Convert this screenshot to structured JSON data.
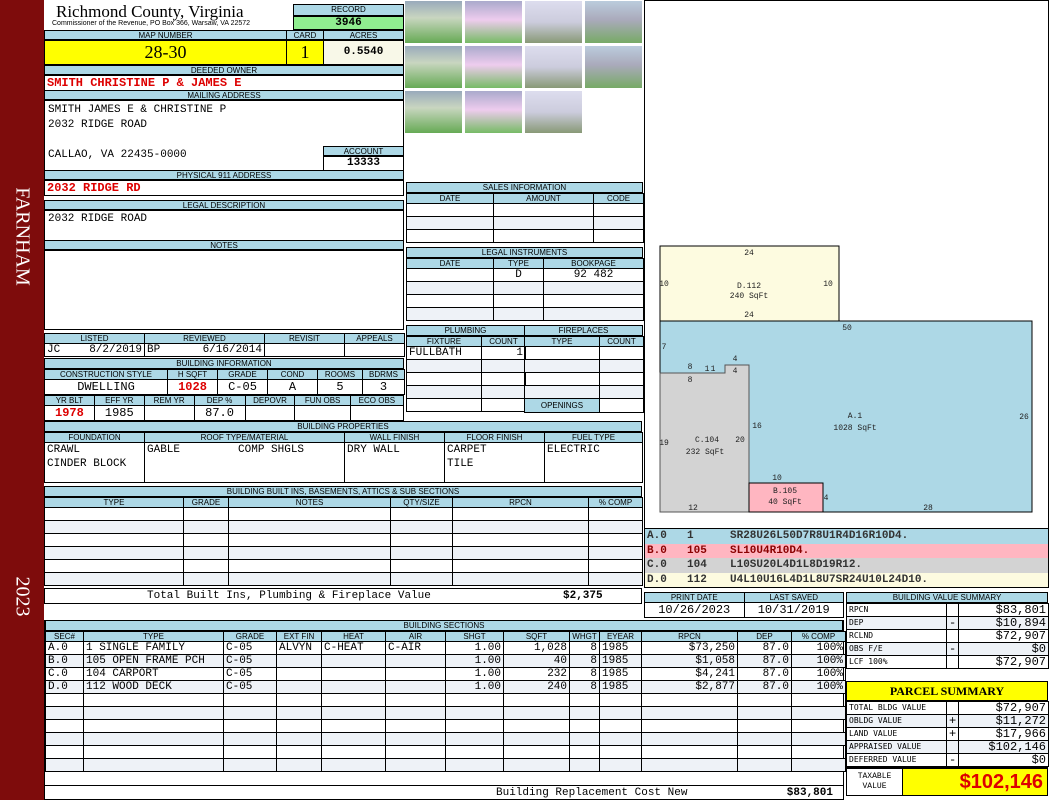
{
  "sidebar": {
    "district": "FARNHAM",
    "year": "2023"
  },
  "header": {
    "title": "Richmond County, Virginia",
    "subtitle": "Commissioner of the Revenue, PO Box 366, Warsaw, VA 22572",
    "record_label": "RECORD",
    "record": "3946"
  },
  "parcel": {
    "map_label": "MAP NUMBER",
    "map": "28-30",
    "card_label": "CARD",
    "card": "1",
    "acres_label": "ACRES",
    "acres": "0.5540"
  },
  "owner": {
    "label": "DEEDED OWNER",
    "value": "SMITH CHRISTINE P & JAMES E"
  },
  "mailing": {
    "label": "MAILING ADDRESS",
    "line1": "SMITH JAMES E & CHRISTINE P",
    "line2": "2032 RIDGE ROAD",
    "line3": "CALLAO, VA 22435-0000",
    "account_label": "ACCOUNT",
    "account": "13333"
  },
  "physical": {
    "label": "PHYSICAL 911 ADDRESS",
    "value": "2032 RIDGE RD"
  },
  "legal": {
    "label": "LEGAL DESCRIPTION",
    "value": "2032 RIDGE ROAD"
  },
  "notes": {
    "label": "NOTES"
  },
  "review": {
    "headers": [
      "LISTED",
      "REVIEWED",
      "REVISIT",
      "APPEALS"
    ],
    "listed_by": "JC",
    "listed": "8/2/2019",
    "reviewed_by": "BP",
    "reviewed": "6/16/2014"
  },
  "building_info": {
    "label": "BUILDING INFORMATION",
    "h1": [
      "CONSTRUCTION STYLE",
      "H SQFT",
      "GRADE",
      "COND",
      "ROOMS",
      "BDRMS"
    ],
    "v1": [
      "DWELLING",
      "1028",
      "C-05",
      "A",
      "5",
      "3"
    ],
    "h2": [
      "YR BLT",
      "EFF YR",
      "REM YR",
      "DEP %",
      "DEPOVR",
      "FUN OBS",
      "ECO OBS"
    ],
    "v2": [
      "1978",
      "1985",
      "",
      "87.0",
      "",
      "",
      ""
    ]
  },
  "properties": {
    "label": "BUILDING PROPERTIES",
    "headers": [
      "FOUNDATION",
      "ROOF TYPE/MATERIAL",
      "WALL FINISH",
      "FLOOR FINISH",
      "FUEL TYPE"
    ],
    "foundation": [
      "CRAWL",
      "CINDER BLOCK"
    ],
    "roof_type": "GABLE",
    "roof_material": "COMP SHGLS",
    "wall": "DRY WALL",
    "floor": [
      "CARPET",
      "TILE"
    ],
    "fuel": "ELECTRIC"
  },
  "builtins": {
    "label": "BUILDING BUILT INS, BASEMENTS, ATTICS & SUB SECTIONS",
    "headers": [
      "TYPE",
      "GRADE",
      "NOTES",
      "QTY/SIZE",
      "RPCN",
      "% COMP"
    ],
    "total_label": "Total Built Ins, Plumbing & Fireplace Value",
    "total": "$2,375"
  },
  "sales": {
    "label": "SALES INFORMATION",
    "headers": [
      "DATE",
      "AMOUNT",
      "CODE"
    ]
  },
  "instruments": {
    "label": "LEGAL INSTRUMENTS",
    "headers": [
      "DATE",
      "TYPE",
      "BOOKPAGE"
    ],
    "rows": [
      [
        "",
        "D",
        "92 482"
      ]
    ]
  },
  "plumbing": {
    "label": "PLUMBING",
    "headers": [
      "FIXTURE",
      "COUNT"
    ],
    "rows": [
      [
        "FULLBATH",
        "1"
      ]
    ]
  },
  "fireplaces": {
    "label": "FIREPLACES",
    "headers": [
      "TYPE",
      "COUNT"
    ],
    "openings_label": "OPENINGS"
  },
  "sketch": {
    "areas": [
      {
        "id": "D.112",
        "sqft": "240 SqFt",
        "color": "#fdfbe0"
      },
      {
        "id": "A.1",
        "sqft": "1028 SqFt",
        "color": "#add8e6"
      },
      {
        "id": "C.104",
        "sqft": "232 SqFt",
        "color": "#d3d3d3"
      },
      {
        "id": "B.105",
        "sqft": "40 SqFt",
        "color": "#ffb6c1"
      }
    ],
    "dims": [
      "24",
      "10",
      "10",
      "24",
      "50",
      "7",
      "8",
      "1",
      "1",
      "4",
      "4",
      "8",
      "16",
      "20",
      "19",
      "26",
      "10",
      "4",
      "12",
      "28"
    ]
  },
  "sketch_legend": [
    {
      "sec": "A.0",
      "code": "1",
      "path": "SR28U26L50D7R8U1R4D16R10D4.",
      "color": "#add8e6"
    },
    {
      "sec": "B.0",
      "code": "105",
      "path": "SL10U4R10D4.",
      "color": "#ffb6c1"
    },
    {
      "sec": "C.0",
      "code": "104",
      "path": "L10SU20L4D1L8D19R12.",
      "color": "#d3d3d3"
    },
    {
      "sec": "D.0",
      "code": "112",
      "path": "U4L10U16L4D1L8U7SR24U10L24D10.",
      "color": "#fdfbe0"
    }
  ],
  "dates": {
    "print_label": "PRINT DATE",
    "print": "10/26/2023",
    "saved_label": "LAST SAVED",
    "saved": "10/31/2019"
  },
  "sections": {
    "label": "BUILDING SECTIONS",
    "headers": [
      "SEC#",
      "TYPE",
      "GRADE",
      "EXT FIN",
      "HEAT",
      "AIR",
      "SHGT",
      "SQFT",
      "WHGT",
      "EYEAR",
      "RPCN",
      "DEP",
      "% COMP"
    ],
    "rows": [
      [
        "A.0",
        "1 SINGLE FAMILY",
        "C-05",
        "ALVYN",
        "C-HEAT",
        "C-AIR",
        "1.00",
        "1,028",
        "8",
        "1985",
        "$73,250",
        "87.0",
        "100%"
      ],
      [
        "B.0",
        "105 OPEN FRAME PCH",
        "C-05",
        "",
        "",
        "",
        "1.00",
        "40",
        "8",
        "1985",
        "$1,058",
        "87.0",
        "100%"
      ],
      [
        "C.0",
        "104 CARPORT",
        "C-05",
        "",
        "",
        "",
        "1.00",
        "232",
        "8",
        "1985",
        "$4,241",
        "87.0",
        "100%"
      ],
      [
        "D.0",
        "112 WOOD DECK",
        "C-05",
        "",
        "",
        "",
        "1.00",
        "240",
        "8",
        "1985",
        "$2,877",
        "87.0",
        "100%"
      ]
    ],
    "footer_label": "Building Replacement Cost New",
    "footer_value": "$83,801"
  },
  "value_summary": {
    "label": "BUILDING VALUE SUMMARY",
    "rows": [
      [
        "RPCN",
        "",
        "$83,801"
      ],
      [
        "DEP",
        "-",
        "$10,894"
      ],
      [
        "RCLND",
        "",
        "$72,907"
      ],
      [
        "OBS F/E",
        "-",
        "$0"
      ],
      [
        "LCF 100%",
        "",
        "$72,907"
      ]
    ]
  },
  "parcel_summary": {
    "label": "PARCEL SUMMARY",
    "rows": [
      [
        "TOTAL BLDG VALUE",
        "",
        "$72,907"
      ],
      [
        "OBLDG VALUE",
        "+",
        "$11,272"
      ],
      [
        "LAND VALUE",
        "+",
        "$17,966"
      ],
      [
        "APPRAISED VALUE",
        "",
        "$102,146"
      ],
      [
        "DEFERRED VALUE",
        "-",
        "$0"
      ]
    ],
    "taxable_label": "TAXABLE VALUE",
    "taxable": "$102,146"
  },
  "colors": {
    "header_blue": "#add8e6",
    "highlight_yellow": "#ffff00",
    "record_green": "#90ee90",
    "sidebar": "#7e0c0c",
    "alert_red": "#dd0000"
  }
}
